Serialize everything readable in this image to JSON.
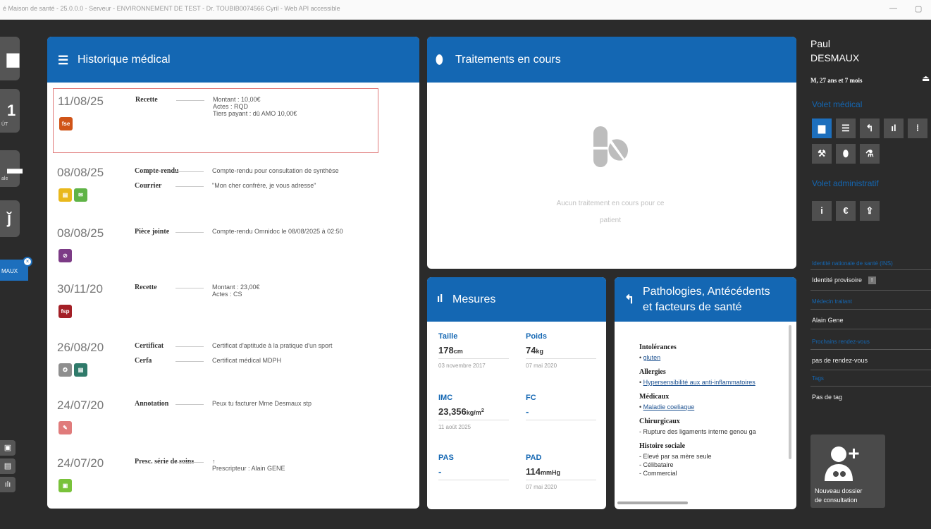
{
  "window": {
    "title": "é Maison de santé - 25.0.0.0 - Serveur - ENVIRONNEMENT DE TEST - Dr. TOUBIB0074566 Cyril - Web API accessible",
    "minimize_icon": "minus",
    "maximize_icon": "square"
  },
  "left_rail": {
    "tiles": [
      {
        "icon": "grid-icon",
        "glyph": "▆",
        "label": ""
      },
      {
        "icon": "calendar-icon",
        "glyph": "1",
        "label": "ÛT"
      },
      {
        "icon": "document-icon",
        "glyph": "▬",
        "label": "ale"
      },
      {
        "icon": "users-icon",
        "glyph": "ǰ",
        "label": ""
      }
    ],
    "patient_tab": "MAUX",
    "patient_tab_close": "×",
    "mini_buttons": [
      "▣",
      "▤",
      "ılı"
    ]
  },
  "historique": {
    "title": "Historique médical",
    "icon": "list-icon",
    "entries": [
      {
        "date": "11/08/25",
        "selected": true,
        "badges": [
          {
            "text": "fse",
            "color": "#d05418"
          }
        ],
        "lines": [
          {
            "type": "Recette",
            "desc": [
              "Montant : 10,00€",
              "Actes : RQD",
              "Tiers payant : dû AMO 10,00€"
            ]
          }
        ]
      },
      {
        "date": "08/08/25",
        "selected": false,
        "badges": [
          {
            "text": "▤",
            "color": "#e9b81c"
          },
          {
            "text": "✉",
            "color": "#5fb346"
          }
        ],
        "lines": [
          {
            "type": "Compte-rendu",
            "desc": [
              "Compte-rendu pour consultation de synthèse"
            ]
          },
          {
            "type": "Courrier",
            "desc": [
              "\"Mon cher confrère, je vous adresse\""
            ]
          }
        ]
      },
      {
        "date": "08/08/25",
        "selected": false,
        "badges": [
          {
            "text": "⊘",
            "color": "#7c3b86"
          }
        ],
        "lines": [
          {
            "type": "Pièce jointe",
            "desc": [
              "Compte-rendu Omnidoc le 08/08/2025 à 02:50"
            ]
          }
        ]
      },
      {
        "date": "30/11/20",
        "selected": false,
        "badges": [
          {
            "text": "fsp",
            "color": "#a31f26"
          }
        ],
        "lines": [
          {
            "type": "Recette",
            "desc": [
              "Montant : 23,00€",
              "Actes : CS"
            ]
          }
        ]
      },
      {
        "date": "26/08/20",
        "selected": false,
        "badges": [
          {
            "text": "✪",
            "color": "#8e8e8e"
          },
          {
            "text": "▤",
            "color": "#2f7a6a"
          }
        ],
        "lines": [
          {
            "type": "Certificat",
            "desc": [
              "Certificat d'aptitude à la pratique d'un sport"
            ]
          },
          {
            "type": "Cerfa",
            "desc": [
              "Certificat médical MDPH"
            ]
          }
        ]
      },
      {
        "date": "24/07/20",
        "selected": false,
        "badges": [
          {
            "text": "✎",
            "color": "#e07b7b"
          }
        ],
        "lines": [
          {
            "type": "Annotation",
            "desc": [
              "Peux tu facturer Mme Desmaux stp"
            ]
          }
        ]
      },
      {
        "date": "24/07/20",
        "selected": false,
        "badges": [
          {
            "text": "▣",
            "color": "#79c23a"
          }
        ],
        "lines": [
          {
            "type": "Presc. série de soins",
            "desc": [
              "↑",
              "Prescripteur : Alain GENE"
            ]
          }
        ]
      }
    ]
  },
  "traitements": {
    "title": "Traitements en cours",
    "icon": "pills-icon",
    "empty_line1": "Aucun traitement en cours pour ce",
    "empty_line2": "patient"
  },
  "mesures": {
    "title": "Mesures",
    "icon": "bar-chart-icon",
    "cells": [
      {
        "label": "Taille",
        "value": "178",
        "unit": "cm",
        "sup": "",
        "date": "03 novembre 2017"
      },
      {
        "label": "Poids",
        "value": "74",
        "unit": "kg",
        "sup": "",
        "date": "07 mai 2020"
      },
      {
        "label": "IMC",
        "value": "23,356",
        "unit": "kg/m",
        "sup": "2",
        "date": "11 août 2025"
      },
      {
        "label": "FC",
        "value": "-",
        "unit": "",
        "sup": "",
        "date": ""
      },
      {
        "label": "PAS",
        "value": "-",
        "unit": "",
        "sup": "",
        "date": ""
      },
      {
        "label": "PAD",
        "value": "114",
        "unit": "mmHg",
        "sup": "",
        "date": "07 mai 2020"
      }
    ]
  },
  "pathologies": {
    "title_line1": "Pathologies, Antécédents",
    "title_line2": "et facteurs de santé",
    "icon": "reply-icon",
    "sections": [
      {
        "title": "Intolérances",
        "items": [
          {
            "bullet": "•",
            "text": "gluten",
            "link": true
          }
        ]
      },
      {
        "title": "Allergies",
        "items": [
          {
            "bullet": "•",
            "text": "Hypersensibilité aux anti-inflammatoires",
            "link": true
          }
        ]
      },
      {
        "title": "Médicaux",
        "items": [
          {
            "bullet": "•",
            "text": "Maladie coeliaque",
            "link": true
          }
        ]
      },
      {
        "title": "Chirurgicaux",
        "items": [
          {
            "bullet": "-",
            "text": "Rupture des ligaments interne genou ga",
            "link": false
          }
        ]
      },
      {
        "title": "Histoire sociale",
        "items": [
          {
            "bullet": "-",
            "text": "Elevé par sa mère seule",
            "link": false
          },
          {
            "bullet": "-",
            "text": "Célibataire",
            "link": false
          },
          {
            "bullet": "-",
            "text": "Commercial",
            "link": false
          }
        ]
      }
    ]
  },
  "patient": {
    "first_name": "Paul",
    "last_name": "DESMAUX",
    "info": "M, 27 ans et 7 mois"
  },
  "sidebar": {
    "volet_medical": "Volet médical",
    "volet_administratif": "Volet administratif",
    "medical_tools": [
      {
        "icon": "summary-icon",
        "glyph": "▆",
        "active": true
      },
      {
        "icon": "list-icon",
        "glyph": "☰",
        "active": false
      },
      {
        "icon": "reply-icon",
        "glyph": "↰",
        "active": false
      },
      {
        "icon": "bar-chart-icon",
        "glyph": "ıl",
        "active": false
      },
      {
        "icon": "more-icon",
        "glyph": "⁞",
        "active": false
      },
      {
        "icon": "tools-icon",
        "glyph": "⚒",
        "active": false
      },
      {
        "icon": "pill-icon",
        "glyph": "⬮",
        "active": false
      },
      {
        "icon": "flask-icon",
        "glyph": "⚗",
        "active": false
      }
    ],
    "admin_tools": [
      {
        "icon": "info-icon",
        "glyph": "i"
      },
      {
        "icon": "euro-icon",
        "glyph": "€"
      },
      {
        "icon": "upload-icon",
        "glyph": "⇪"
      }
    ],
    "ins_label": "Identité nationale de santé (INS)",
    "ins_value": "Identité provisoire",
    "ins_badge": "!",
    "medecin_label": "Médecin traitant",
    "medecin_value": "Alain Gene",
    "rdv_label": "Prochains rendez-vous",
    "rdv_value": "pas de rendez-vous",
    "tags_label": "Tags",
    "tags_value": "Pas de tag",
    "new_dossier_line1": "Nouveau dossier",
    "new_dossier_line2": "de consultation"
  }
}
